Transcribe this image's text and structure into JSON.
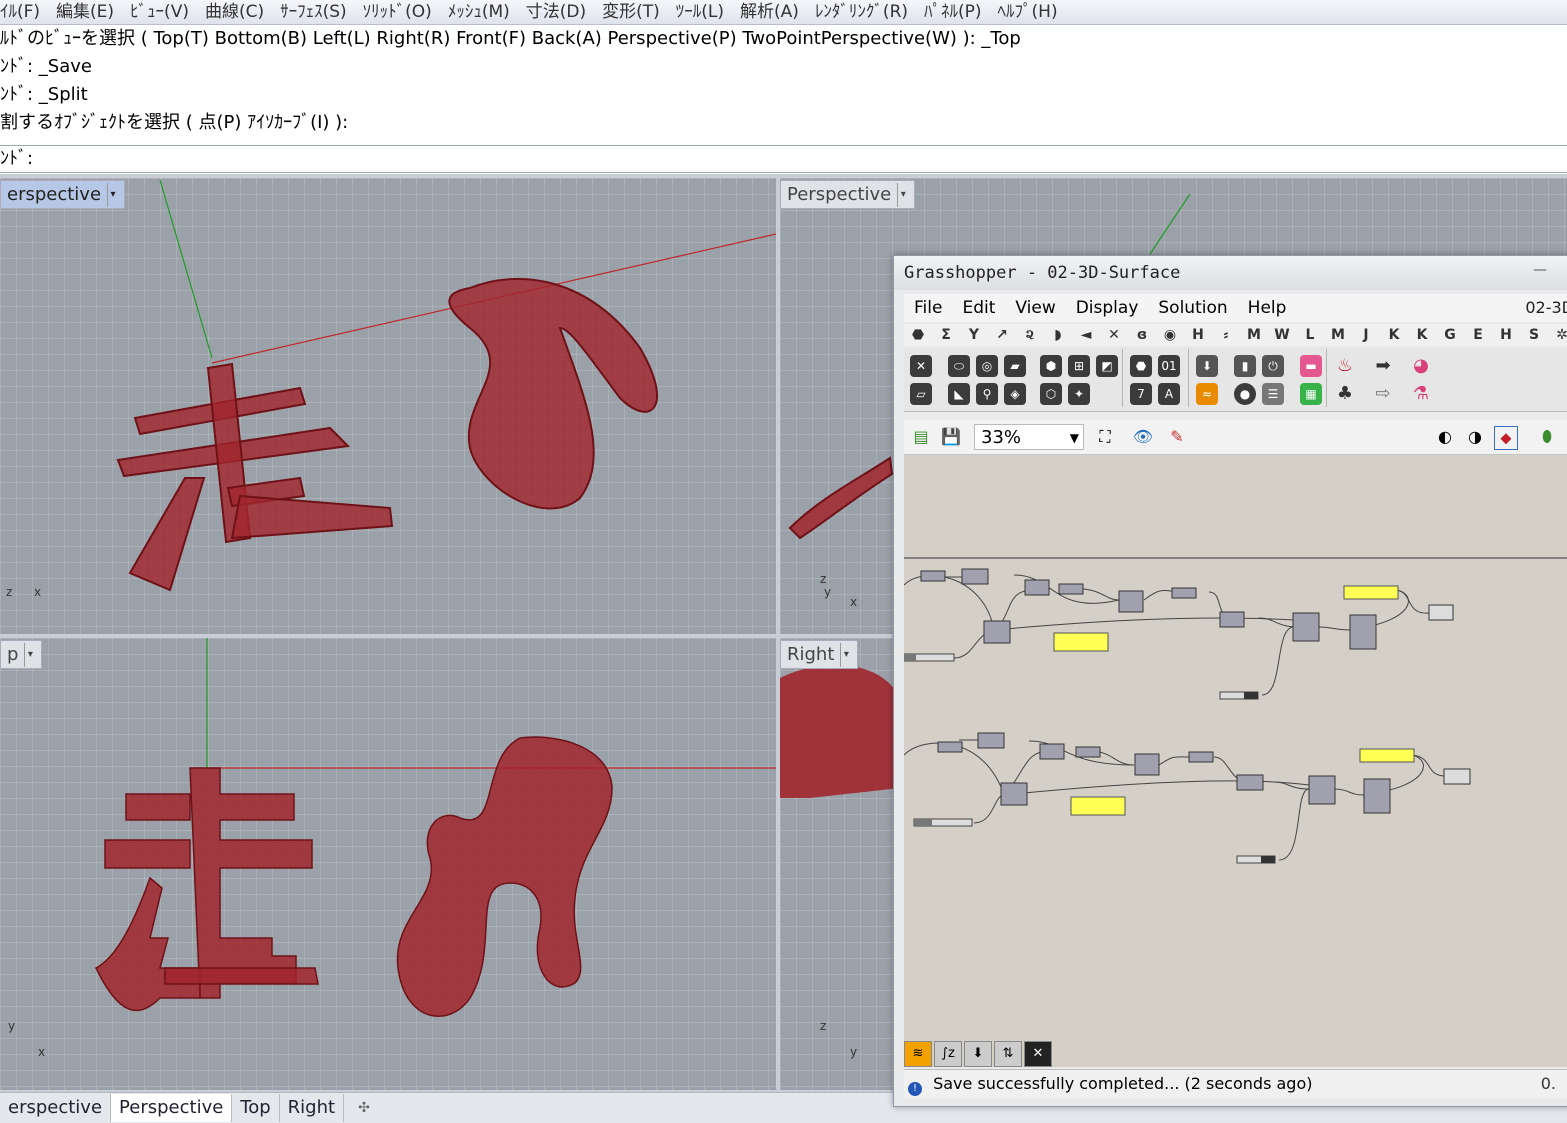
{
  "menu": [
    "ｲﾙ(F)",
    "編集(E)",
    "ﾋﾞｭｰ(V)",
    "曲線(C)",
    "ｻｰﾌｪｽ(S)",
    "ｿﾘｯﾄﾞ(O)",
    "ﾒｯｼｭ(M)",
    "寸法(D)",
    "変形(T)",
    "ﾂｰﾙ(L)",
    "解析(A)",
    "ﾚﾝﾀﾞﾘﾝｸﾞ(R)",
    "ﾊﾟﾈﾙ(P)",
    "ﾍﾙﾌﾟ(H)"
  ],
  "command_history": [
    "ﾙﾄﾞのﾋﾞｭｰを選択 ( Top(T)  Bottom(B)  Left(L)  Right(R)  Front(F)  Back(A)  Perspective(P)  TwoPointPerspective(W) ): _Top",
    "ﾝﾄﾞ: _Save",
    "ﾝﾄﾞ: _Split",
    "割するｵﾌﾞｼﾞｪｸﾄを選択 ( 点(P)  ｱｲｿｶｰﾌﾞ(I) ):"
  ],
  "command_prompt": "ﾝﾄﾞ:",
  "viewports": {
    "top_left": "erspective",
    "top_right": "Perspective",
    "bottom_left": "p",
    "bottom_right": "Right"
  },
  "bottom_tabs": [
    "erspective",
    "Perspective",
    "Top",
    "Right"
  ],
  "grasshopper": {
    "title": "Grasshopper - 02-3D-Surface",
    "doc_tab": "02-3D",
    "menu": [
      "File",
      "Edit",
      "View",
      "Display",
      "Solution",
      "Help"
    ],
    "categories": [
      "⬣",
      "Σ",
      "Y",
      "↗",
      "૨",
      "◗",
      "◄",
      "✕",
      "ɞ",
      "◉",
      "H",
      "⸗",
      "M",
      "W",
      "L",
      "M",
      "J",
      "K",
      "K",
      "G",
      "E",
      "H",
      "S",
      "✲"
    ],
    "zoom": "33%",
    "status": "Save successfully completed... (2 seconds ago)",
    "status_right": "0."
  },
  "colors": {
    "model_red": "#a1262e",
    "viewport_grid": "#9ba1a8",
    "gh_canvas": "#d4d0c8",
    "panel_yellow": "#ffff55"
  }
}
